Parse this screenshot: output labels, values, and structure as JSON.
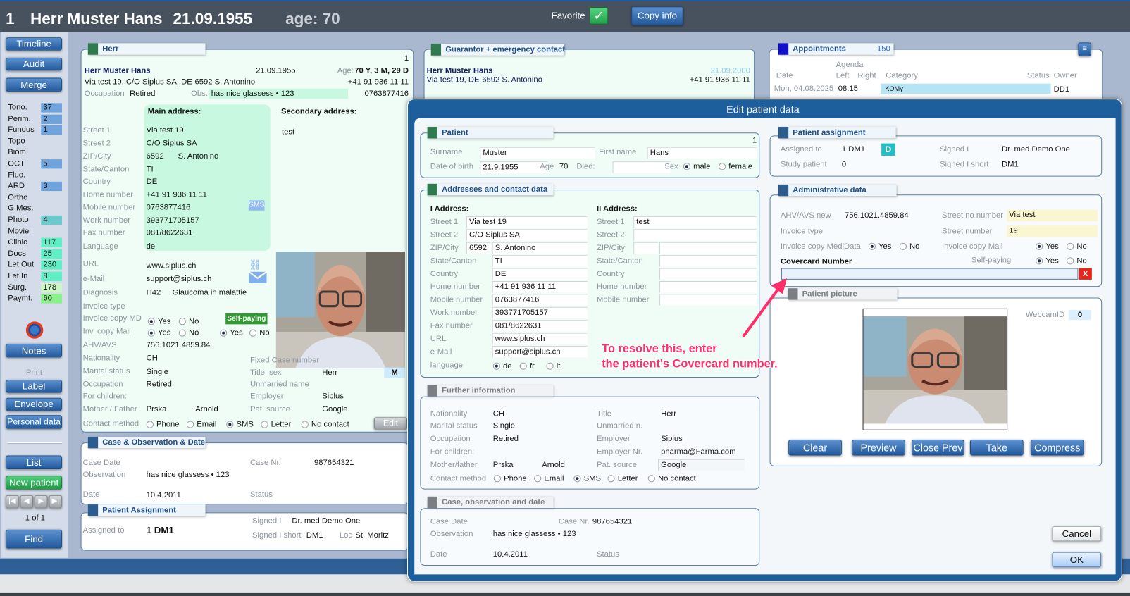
{
  "header": {
    "record_no": "1",
    "name": "Herr Muster Hans",
    "dob": "21.09.1955",
    "age": "age: 70",
    "favorite_label": "Favorite",
    "copy_info": "Copy info"
  },
  "sidebar": {
    "timeline": "Timeline",
    "audit": "Audit",
    "merge": "Merge",
    "notes": "Notes",
    "print_label": "Print",
    "label": "Label",
    "envelope": "Envelope",
    "personal_data": "Personal data",
    "list": "List",
    "new_patient": "New patient",
    "find": "Find",
    "pager": "1 of 1",
    "nav": [
      "|◀",
      "◀",
      "▶",
      "▶|"
    ],
    "counters": [
      {
        "label": "Tono.",
        "value": "37",
        "color": "#6fa3dc"
      },
      {
        "label": "Perim.",
        "value": "2",
        "color": "#6fa3dc"
      },
      {
        "label": "Fundus",
        "value": "1",
        "color": "#6fa3dc"
      },
      {
        "label": "Topo",
        "value": null,
        "color": null
      },
      {
        "label": "Biom.",
        "value": null,
        "color": null
      },
      {
        "label": "OCT",
        "value": "5",
        "color": "#6fa3dc"
      },
      {
        "label": "Fluo.",
        "value": null,
        "color": null
      },
      {
        "label": "ARD",
        "value": "3",
        "color": "#6fa3dc"
      },
      {
        "label": "Ortho",
        "value": null,
        "color": null
      },
      {
        "label": "G.Mes.",
        "value": null,
        "color": null
      },
      {
        "label": "Photo",
        "value": "4",
        "color": "#6cc9cc"
      },
      {
        "label": "Movie",
        "value": null,
        "color": null
      },
      {
        "label": "Clinic",
        "value": "117",
        "color": "#5ef0c4"
      },
      {
        "label": "Docs",
        "value": "25",
        "color": "#5ef0c4"
      },
      {
        "label": "Let.Out",
        "value": "230",
        "color": "#5ef0c4"
      },
      {
        "label": "Let.In",
        "value": "8",
        "color": "#5ef0c4"
      },
      {
        "label": "Surg.",
        "value": "178",
        "color": "#cdf6c6"
      },
      {
        "label": "Paymt.",
        "value": "60",
        "color": "#8af08a"
      }
    ]
  },
  "patient_panel": {
    "title": "Herr",
    "number": "1",
    "name": "Herr Muster Hans",
    "dob": "21.09.1955",
    "age_label": "Age:",
    "age": "70 Y, 3 M, 29 D",
    "address_line": "Via test 19, C/O Siplus SA, DE-6592 S. Antonino",
    "phone": "+41 91 936 11 11",
    "occupation_label": "Occupation",
    "occupation": "Retired",
    "obs_label": "Obs.",
    "obs": "has nice glassess • 123",
    "mobile": "0763877416",
    "main_heading": "Main address:",
    "secondary_heading": "Secondary address:",
    "secondary_street": "test",
    "labels": {
      "street1": "Street 1",
      "street2": "Street 2",
      "zip": "ZIP/City",
      "canton": "State/Canton",
      "country": "Country",
      "home": "Home number",
      "mobile": "Mobile number",
      "work": "Work number",
      "fax": "Fax number",
      "language": "Language",
      "url": "URL",
      "email": "e-Mail",
      "diagnosis": "Diagnosis",
      "invoice_type": "Invoice type",
      "invoice_copy_md": "Invoice copy MD",
      "inv_copy_mail": "Inv. copy Mail",
      "ahv": "AHV/AVS",
      "nationality": "Nationality",
      "marital": "Marital status",
      "occupation": "Occupation",
      "children": "For children:",
      "parents": "Mother / Father",
      "contact": "Contact method",
      "fixed_case": "Fixed Case number",
      "title_sex": "Title, sex",
      "unmarried": "Unmarried name",
      "employer": "Employer",
      "pat_source": "Pat. source"
    },
    "main": {
      "street1": "Via test 19",
      "street2": "C/O Siplus SA",
      "zip": "6592",
      "city": "S. Antonino",
      "canton": "TI",
      "country": "DE",
      "home": "+41 91 936 11 11",
      "mobile": "0763877416",
      "work": "393771705157",
      "fax": "081/8622631",
      "language": "de"
    },
    "sms_badge": "SMS",
    "url": "www.siplus.ch",
    "email": "support@siplus.ch",
    "diagnosis_code": "H42",
    "diagnosis": "Glaucoma in malattie",
    "invoice_copy_md": {
      "options": [
        "Yes",
        "No"
      ],
      "selected": "Yes"
    },
    "inv_copy_mail": {
      "options": [
        "Yes",
        "No"
      ],
      "selected": "Yes"
    },
    "self_paying_badge": "Self-paying",
    "self_paying": {
      "options": [
        "Yes",
        "No"
      ],
      "selected": "Yes"
    },
    "ahv": "756.1021.4859.84",
    "nationality": "CH",
    "marital": "Single",
    "occupation2": "Retired",
    "mother": "Prska",
    "father": "Arnold",
    "sex": "M",
    "employer": "Siplus",
    "pat_source": "Google",
    "contact": {
      "options": [
        "Phone",
        "Email",
        "SMS",
        "Letter",
        "No contact"
      ],
      "selected": "SMS"
    },
    "edit": "Edit"
  },
  "case_panel": {
    "title": "Case & Observation & Date",
    "case_date_label": "Case Date",
    "case_nr_label": "Case Nr.",
    "case_nr": "987654321",
    "observation_label": "Observation",
    "observation": "has nice glassess • 123",
    "date_label": "Date",
    "date": "10.4.2011",
    "status_label": "Status"
  },
  "assignment_panel": {
    "title": "Patient Assignment",
    "assigned_label": "Assigned to",
    "assigned": "1 DM1",
    "signed_label": "Signed I",
    "signed": "Dr. med Demo One",
    "signed_short_label": "Signed I short",
    "signed_short": "DM1",
    "loc_label": "Loc",
    "loc": "St. Moritz"
  },
  "guarantor_panel": {
    "title": "Guarantor + emergency contact",
    "name": "Herr Muster Hans",
    "date": "21.09.2000",
    "address": "Via test 19, DE-6592 S. Antonino",
    "phone": "+41 91 936 11 11"
  },
  "appointments": {
    "title": "Appointments",
    "count": "150",
    "agenda": "Agenda",
    "columns": [
      "Date",
      "Left",
      "Right",
      "Category",
      "Status",
      "Owner"
    ],
    "rows": [
      {
        "date": "Mon, 04.08.2025",
        "left": "08:15",
        "right": "",
        "category": "KOMy",
        "status": "",
        "owner": "DD1"
      }
    ]
  },
  "modal": {
    "title": "Edit patient data",
    "patient": {
      "title": "Patient",
      "number": "1",
      "surname_label": "Surname",
      "surname": "Muster",
      "first_name_label": "First name",
      "first_name": "Hans",
      "dob_label": "Date of birth",
      "dob": "21.9.1955",
      "age_label": "Age",
      "age": "70",
      "died_label": "Died:",
      "died": "",
      "sex_label": "Sex",
      "sex": {
        "options": [
          "male",
          "female"
        ],
        "selected": "male"
      }
    },
    "addresses": {
      "title": "Addresses and contact data",
      "addr1_heading": "I Address:",
      "addr2_heading": "II Address:",
      "labels": {
        "street1": "Street 1",
        "street2": "Street 2",
        "zip": "ZIP/City",
        "canton": "State/Canton",
        "country": "Country",
        "home": "Home number",
        "mobile": "Mobile number",
        "work": "Work number",
        "fax": "Fax number",
        "url": "URL",
        "email": "e-Mail",
        "language": "language"
      },
      "addr1": {
        "street1": "Via test 19",
        "street2": "C/O Siplus SA",
        "zip": "6592",
        "city": "S. Antonino",
        "canton": "TI",
        "country": "DE",
        "home": "+41 91 936 11 11",
        "mobile": "0763877416",
        "work": "393771705157",
        "fax": "081/8622631",
        "url": "www.siplus.ch",
        "email": "support@siplus.ch"
      },
      "addr2": {
        "street1": "test",
        "street2": "",
        "zip": "",
        "city": "",
        "canton": "",
        "country": "",
        "home": "",
        "mobile": ""
      },
      "language": {
        "options": [
          "de",
          "fr",
          "it"
        ],
        "selected": "de"
      }
    },
    "further": {
      "title": "Further information",
      "nationality_label": "Nationality",
      "nationality": "CH",
      "marital_label": "Marital status",
      "marital": "Single",
      "occupation_label": "Occupation",
      "occupation": "Retired",
      "children_label": "For children:",
      "parents_label": "Mother/father",
      "mother": "Prska",
      "father": "Arnold",
      "contact_label": "Contact method",
      "contact": {
        "options": [
          "Phone",
          "Email",
          "SMS",
          "Letter",
          "No contact"
        ],
        "selected": "SMS"
      },
      "title_label": "Title",
      "title_value": "Herr",
      "unmarried_label": "Unmarried n.",
      "employer_label": "Employer",
      "employer": "Siplus",
      "employer_nr_label": "Employer Nr.",
      "employer_nr": "pharma@Farma.com",
      "pat_source_label": "Pat. source",
      "pat_source": "Google"
    },
    "case": {
      "title": "Case, observation and date",
      "case_date_label": "Case Date",
      "case_nr_label": "Case Nr.",
      "case_nr": "987654321",
      "observation_label": "Observation",
      "observation": "has nice glassess • 123",
      "date_label": "Date",
      "date": "10.4.2011",
      "status_label": "Status"
    },
    "assignment": {
      "title": "Patient assignment",
      "assigned_label": "Assigned to",
      "assigned": "1 DM1",
      "badge": "D",
      "study_label": "Study patient",
      "study": "0",
      "signed_label": "Signed I",
      "signed": "Dr. med Demo One",
      "signed_short_label": "Signed I short",
      "signed_short": "DM1"
    },
    "admin": {
      "title": "Administrative data",
      "ahv_label": "AHV/AVS new",
      "ahv": "756.1021.4859.84",
      "invoice_type_label": "Invoice type",
      "medidata_label": "Invoice copy MediData",
      "medidata": {
        "options": [
          "Yes",
          "No"
        ],
        "selected": "Yes"
      },
      "street_no_number_label": "Street no number",
      "street_no_number": "Via test",
      "street_number_label": "Street number",
      "street_number": "19",
      "invoice_mail_label": "Invoice copy Mail",
      "invoice_mail": {
        "options": [
          "Yes",
          "No"
        ],
        "selected": "Yes"
      },
      "self_paying_label": "Self-paying",
      "self_paying": {
        "options": [
          "Yes",
          "No"
        ],
        "selected": "Yes"
      },
      "covercard_label": "Covercard Number",
      "covercard": "",
      "clear_label": "X"
    },
    "picture": {
      "title": "Patient picture",
      "webcam_label": "WebcamID",
      "webcam": "0",
      "buttons": [
        "Clear",
        "Preview",
        "Close Prev",
        "Take",
        "Compress"
      ]
    },
    "cancel": "Cancel",
    "ok": "OK"
  },
  "annotation": {
    "line1": "To resolve this, enter",
    "line2": "the patient's Covercard number.",
    "color": "#ff2d6a"
  }
}
